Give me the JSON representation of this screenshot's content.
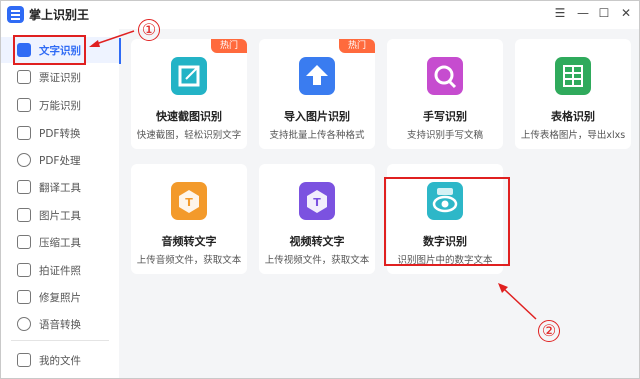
{
  "window": {
    "title": "掌上识别王",
    "controls": {
      "menu": "☰",
      "minimize": "—",
      "maximize": "☐",
      "close": "✕"
    }
  },
  "sidebar": {
    "items": [
      {
        "label": "文字识别",
        "icon": "text-recognition-icon",
        "active": true
      },
      {
        "label": "票证识别",
        "icon": "ticket-icon"
      },
      {
        "label": "万能识别",
        "icon": "universal-scan-icon"
      },
      {
        "label": "PDF转换",
        "icon": "pdf-convert-icon"
      },
      {
        "label": "PDF处理",
        "icon": "pdf-process-icon"
      },
      {
        "label": "翻译工具",
        "icon": "translate-icon"
      },
      {
        "label": "图片工具",
        "icon": "image-icon"
      },
      {
        "label": "压缩工具",
        "icon": "compress-icon"
      },
      {
        "label": "拍证件照",
        "icon": "id-photo-icon"
      },
      {
        "label": "修复照片",
        "icon": "photo-repair-icon"
      },
      {
        "label": "语音转换",
        "icon": "voice-convert-icon"
      }
    ],
    "footer": {
      "label": "我的文件",
      "icon": "my-files-icon"
    }
  },
  "cards": [
    {
      "title": "快速截图识别",
      "subtitle": "快速截图，轻松识别文字",
      "badge": "热门",
      "icon": "screenshot-crop-icon",
      "color": "#23b3c6"
    },
    {
      "title": "导入图片识别",
      "subtitle": "支持批量上传各种格式",
      "badge": "热门",
      "icon": "import-image-icon",
      "color": "#3a7cf0"
    },
    {
      "title": "手写识别",
      "subtitle": "支持识别手写文稿",
      "icon": "handwriting-icon",
      "color": "#c64ccf"
    },
    {
      "title": "表格识别",
      "subtitle": "上传表格图片，导出xlxs",
      "icon": "table-icon",
      "color": "#2faa5c"
    },
    {
      "title": "音频转文字",
      "subtitle": "上传音频文件，获取文本",
      "icon": "audio-to-text-icon",
      "color": "#f39a2b"
    },
    {
      "title": "视频转文字",
      "subtitle": "上传视频文件，获取文本",
      "icon": "video-to-text-icon",
      "color": "#7b52e0"
    },
    {
      "title": "数字识别",
      "subtitle": "识别图片中的数字文本",
      "icon": "number-eye-icon",
      "color": "#2db7c8"
    }
  ],
  "annotations": {
    "marker1": "①",
    "marker2": "②",
    "color": "#e02020"
  },
  "colors": {
    "accent": "#2f6bf5",
    "hot": "#ff6a3d"
  }
}
